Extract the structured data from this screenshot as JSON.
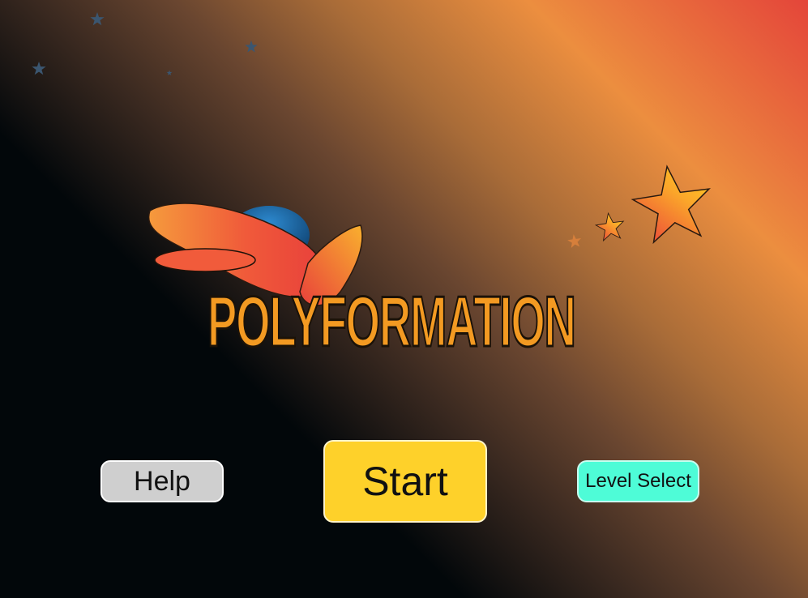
{
  "game": {
    "title": "POLYFORMATION",
    "logo_icon": "winged-planet-icon",
    "accent_colors": {
      "title_fill": "#f39a22",
      "wing_gradient_start": "#f04b3c",
      "wing_gradient_end": "#f9a52e",
      "planet": "#1d6fae",
      "star_gradient_end": "#ffd21f"
    }
  },
  "menu": {
    "help_label": "Help",
    "start_label": "Start",
    "level_select_label": "Level Select",
    "colors": {
      "help": "#cfcfcf",
      "start": "#fed12a",
      "level_select": "#4efcd7"
    }
  },
  "background": {
    "gradient_colors": [
      "#02070a",
      "#6a4630",
      "#ec8e3f",
      "#e4453a"
    ],
    "decor_icon": "star-icon"
  }
}
